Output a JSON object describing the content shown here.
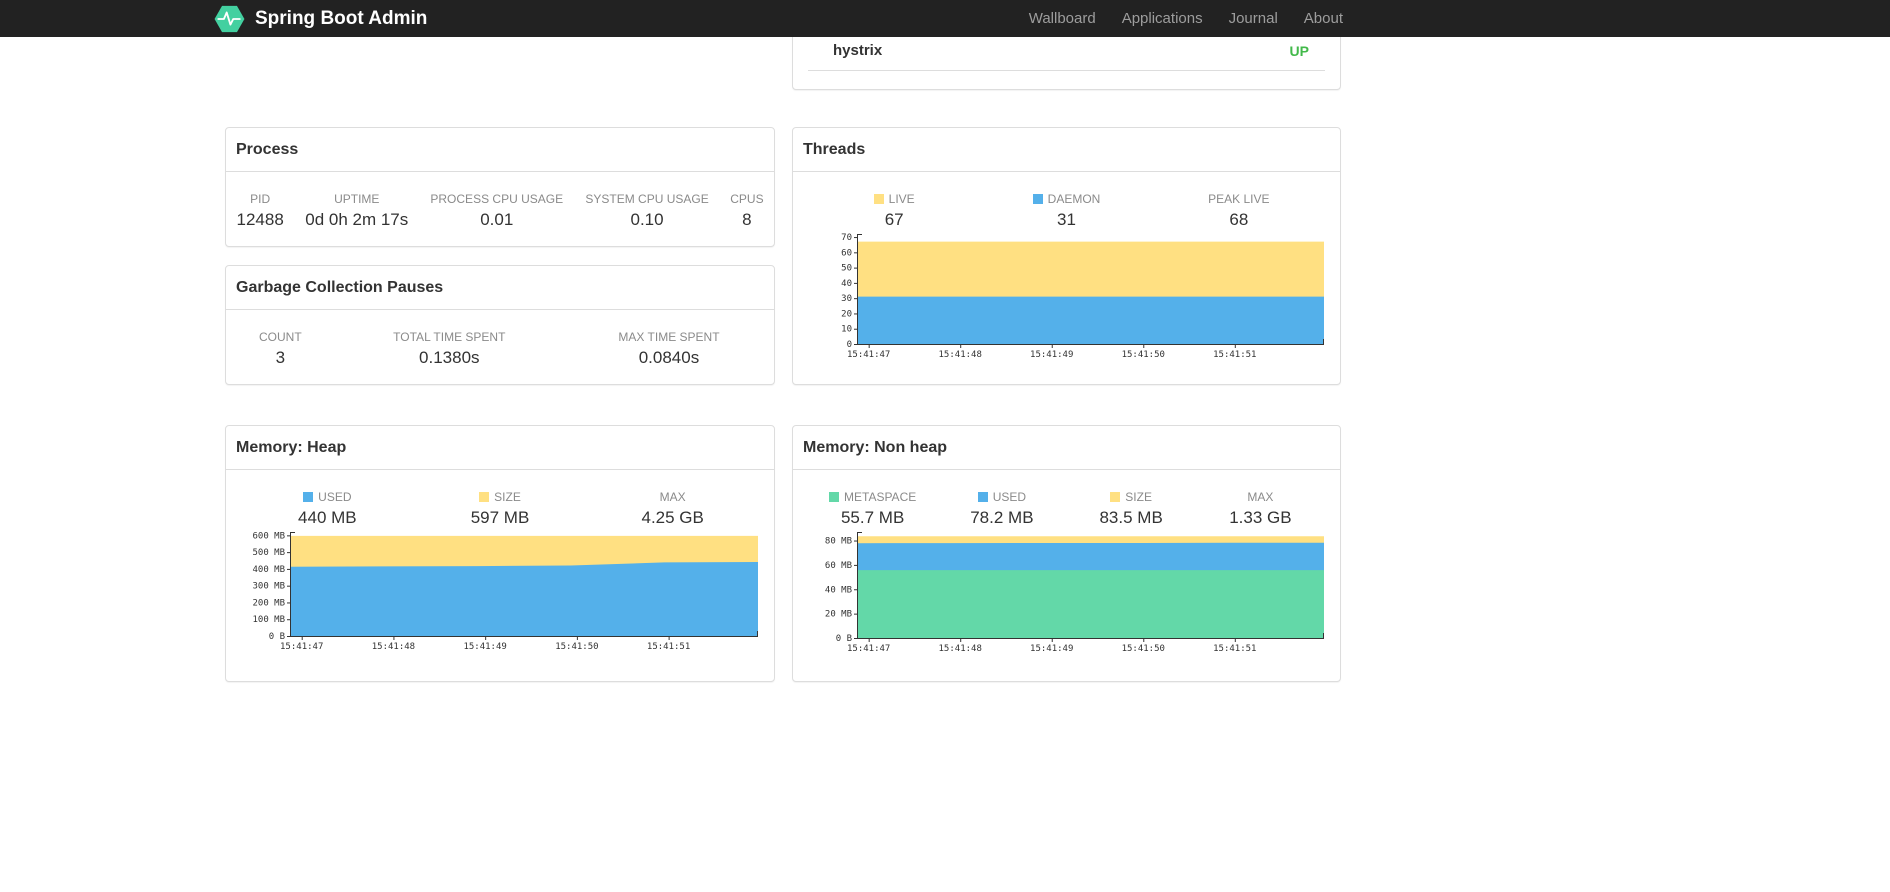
{
  "navbar": {
    "brand": "Spring Boot Admin",
    "logo_color": "#43d0a0",
    "items": [
      {
        "label": "Wallboard"
      },
      {
        "label": "Applications"
      },
      {
        "label": "Journal"
      },
      {
        "label": "About"
      }
    ]
  },
  "applications": {
    "row": {
      "name": "hystrix",
      "status": "UP"
    },
    "status_up_color": "#42b94a"
  },
  "process": {
    "title": "Process",
    "metrics": [
      {
        "label": "PID",
        "value": "12488"
      },
      {
        "label": "UPTIME",
        "value": "0d 0h 2m 17s"
      },
      {
        "label": "PROCESS CPU USAGE",
        "value": "0.01"
      },
      {
        "label": "SYSTEM CPU USAGE",
        "value": "0.10"
      },
      {
        "label": "CPUS",
        "value": "8"
      }
    ]
  },
  "gc": {
    "title": "Garbage Collection Pauses",
    "metrics": [
      {
        "label": "COUNT",
        "value": "3"
      },
      {
        "label": "TOTAL TIME SPENT",
        "value": "0.1380s"
      },
      {
        "label": "MAX TIME SPENT",
        "value": "0.0840s"
      }
    ]
  },
  "threads": {
    "title": "Threads",
    "stats": [
      {
        "label": "LIVE",
        "value": "67"
      },
      {
        "label": "DAEMON",
        "value": "31"
      },
      {
        "label": "PEAK LIVE",
        "value": "68"
      }
    ]
  },
  "memory_heap": {
    "title": "Memory: Heap",
    "stats": [
      {
        "label": "USED",
        "value": "440 MB"
      },
      {
        "label": "SIZE",
        "value": "597 MB"
      },
      {
        "label": "MAX",
        "value": "4.25 GB"
      }
    ]
  },
  "memory_nonheap": {
    "title": "Memory: Non heap",
    "stats": [
      {
        "label": "METASPACE",
        "value": "55.7 MB"
      },
      {
        "label": "USED",
        "value": "78.2 MB"
      },
      {
        "label": "SIZE",
        "value": "83.5 MB"
      },
      {
        "label": "MAX",
        "value": "1.33 GB"
      }
    ]
  },
  "chart_data": [
    {
      "id": "threads",
      "type": "area",
      "title": "Threads",
      "x_ticks": [
        "15:41:47",
        "15:41:48",
        "15:41:49",
        "15:41:50",
        "15:41:51"
      ],
      "x_tick_pos": [
        0.025,
        0.221,
        0.417,
        0.613,
        0.809
      ],
      "ylim": [
        0,
        72
      ],
      "y_ticks": [
        {
          "v": 0,
          "label": "0"
        },
        {
          "v": 10,
          "label": "10"
        },
        {
          "v": 20,
          "label": "20"
        },
        {
          "v": 30,
          "label": "30"
        },
        {
          "v": 40,
          "label": "40"
        },
        {
          "v": 50,
          "label": "50"
        },
        {
          "v": 60,
          "label": "60"
        },
        {
          "v": 70,
          "label": "70"
        }
      ],
      "series": [
        {
          "name": "LIVE",
          "color": "#ffe082",
          "values": [
            67,
            67,
            67,
            67,
            67,
            67
          ]
        },
        {
          "name": "DAEMON",
          "color": "#54b0ea",
          "values": [
            31,
            31,
            31,
            31,
            31,
            31
          ]
        }
      ]
    },
    {
      "id": "memory-heap",
      "type": "area",
      "title": "Memory: Heap",
      "x_ticks": [
        "15:41:47",
        "15:41:48",
        "15:41:49",
        "15:41:50",
        "15:41:51"
      ],
      "x_tick_pos": [
        0.025,
        0.221,
        0.417,
        0.613,
        0.809
      ],
      "ylim": [
        0,
        620
      ],
      "y_ticks": [
        {
          "v": 0,
          "label": "0 B"
        },
        {
          "v": 100,
          "label": "100 MB"
        },
        {
          "v": 200,
          "label": "200 MB"
        },
        {
          "v": 300,
          "label": "300 MB"
        },
        {
          "v": 400,
          "label": "400 MB"
        },
        {
          "v": 500,
          "label": "500 MB"
        },
        {
          "v": 600,
          "label": "600 MB"
        }
      ],
      "series": [
        {
          "name": "SIZE",
          "color": "#ffe082",
          "values": [
            597,
            597,
            597,
            597,
            597,
            597
          ]
        },
        {
          "name": "USED",
          "color": "#54b0ea",
          "values": [
            413,
            415,
            417,
            420,
            439,
            441
          ]
        }
      ]
    },
    {
      "id": "memory-nonheap",
      "type": "area",
      "title": "Memory: Non heap",
      "x_ticks": [
        "15:41:47",
        "15:41:48",
        "15:41:49",
        "15:41:50",
        "15:41:51"
      ],
      "x_tick_pos": [
        0.025,
        0.221,
        0.417,
        0.613,
        0.809
      ],
      "ylim": [
        0,
        87
      ],
      "y_ticks": [
        {
          "v": 0,
          "label": "0 B"
        },
        {
          "v": 20,
          "label": "20 MB"
        },
        {
          "v": 40,
          "label": "40 MB"
        },
        {
          "v": 60,
          "label": "60 MB"
        },
        {
          "v": 80,
          "label": "80 MB"
        }
      ],
      "series": [
        {
          "name": "SIZE",
          "color": "#ffe082",
          "values": [
            83.5,
            83.5,
            83.5,
            83.5,
            83.5,
            83.5
          ]
        },
        {
          "name": "USED",
          "color": "#54b0ea",
          "values": [
            77.8,
            77.9,
            78.0,
            78.0,
            78.1,
            78.2
          ]
        },
        {
          "name": "METASPACE",
          "color": "#63d8a8",
          "values": [
            55.7,
            55.7,
            55.7,
            55.7,
            55.7,
            55.7
          ]
        }
      ]
    }
  ]
}
